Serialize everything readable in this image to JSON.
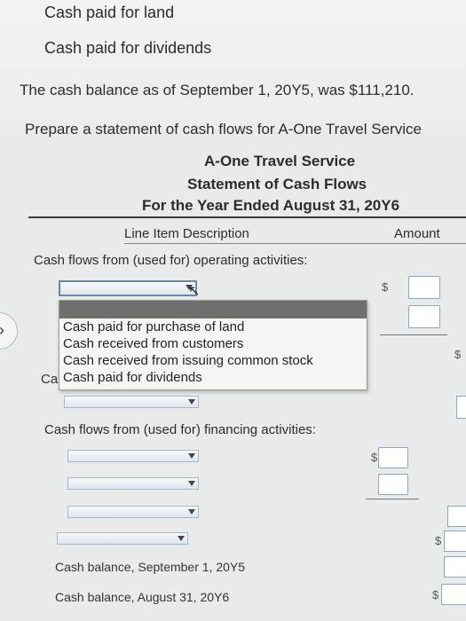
{
  "intro": {
    "line_land": "Cash paid for land",
    "line_dividends": "Cash paid for dividends",
    "balance_note": "The cash balance as of September 1, 20Y5, was $111,210.",
    "instruction": "Prepare a statement of cash flows for A-One Travel Service"
  },
  "statement": {
    "company": "A-One Travel Service",
    "title": "Statement of Cash Flows",
    "period": "For the Year Ended August 31, 20Y6",
    "col_description": "Line Item Description",
    "col_amount": "Amount",
    "operating_heading": "Cash flows from (used for) operating activities:",
    "financing_heading": "Cash flows from (used for) financing activities:",
    "balance_start": "Cash balance, September 1, 20Y5",
    "balance_end": "Cash balance, August 31, 20Y6",
    "currency_symbol": "$"
  },
  "dropdown_menu": {
    "options": [
      "Cash paid for purchase of land",
      "Cash received from customers",
      "Cash received from issuing common stock",
      "Cash paid for dividends"
    ],
    "underlay_text": "Ca"
  },
  "colors": {
    "input_border": "#8aa6c8",
    "menu_header": "#6f6f6f",
    "page_bg": "#e9eaea"
  }
}
